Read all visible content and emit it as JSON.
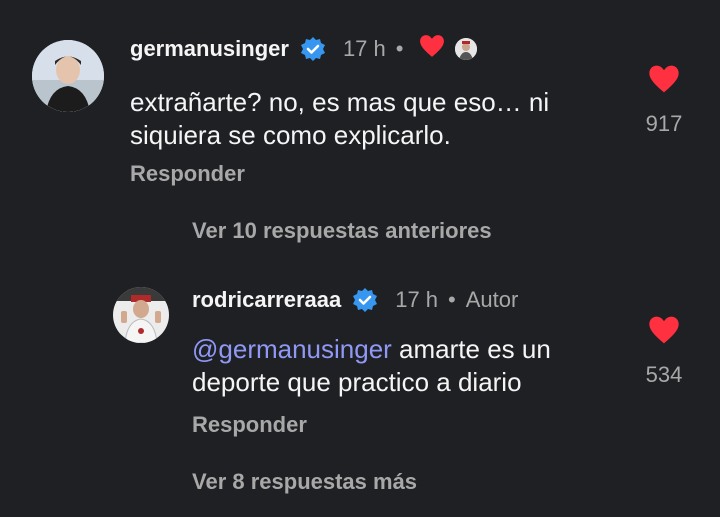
{
  "comment": {
    "username": "germanusinger",
    "time": "17 h",
    "text": "extrañarte? no, es mas que eso… ni siquiera se como explicarlo.",
    "reply_label": "Responder",
    "likes": "917"
  },
  "view_previous": "Ver 10 respuestas anteriores",
  "reply": {
    "username": "rodricarreraaa",
    "time": "17 h",
    "author_tag": "Autor",
    "mention": "@germanusinger",
    "text": " amarte es un deporte que practico a diario",
    "reply_label": "Responder",
    "likes": "534"
  },
  "view_more": "Ver 8 respuestas más",
  "colors": {
    "background": "#1f2024",
    "heart": "#ff3040",
    "verified": "#3797f0",
    "mention": "#8f98f5"
  },
  "icons": {
    "verified": "verified-badge-icon",
    "heart": "heart-icon",
    "creator_like": "heart-icon"
  }
}
